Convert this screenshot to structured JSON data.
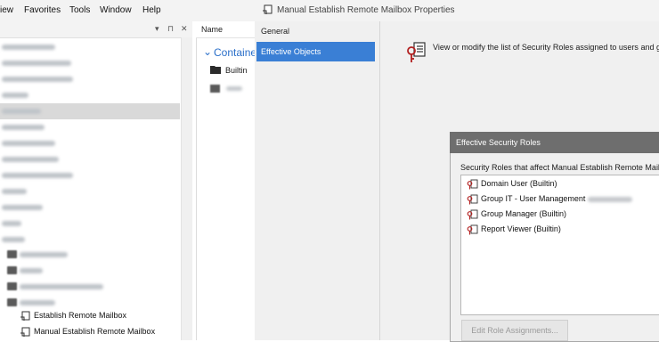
{
  "menu": {
    "items": [
      "iew",
      "Favorites",
      "Tools",
      "Window",
      "Help"
    ]
  },
  "left_toolbar": {
    "pin": "▾ ⊓ ✕"
  },
  "tree": {
    "visible_items": [
      {
        "label": "Establish Remote Mailbox"
      },
      {
        "label": "Manual Establish Remote Mailbox"
      }
    ]
  },
  "list": {
    "column_header": "Name",
    "group_label": "Containe",
    "builtin_label": "Builtin"
  },
  "dialog": {
    "title": "Manual Establish Remote Mailbox Properties",
    "nav": [
      {
        "label": "General"
      },
      {
        "label": "Effective Objects"
      }
    ],
    "description": "View or modify the list of Security Roles assigned to users and gro"
  },
  "esr": {
    "title": "Effective Security Roles",
    "subtitle": "Security Roles that affect Manual Establish Remote Mailbo",
    "roles": [
      {
        "label": "Domain User (Builtin)"
      },
      {
        "label": "Group IT - User Management"
      },
      {
        "label": "Group Manager (Builtin)"
      },
      {
        "label": "Report Viewer (Builtin)"
      }
    ],
    "edit_button": "Edit Role Assignments..."
  },
  "colors": {
    "nav_selected": "#3a7fd5",
    "esr_title_bg": "#6e6e6e",
    "role_icon": "#b21f1f"
  }
}
